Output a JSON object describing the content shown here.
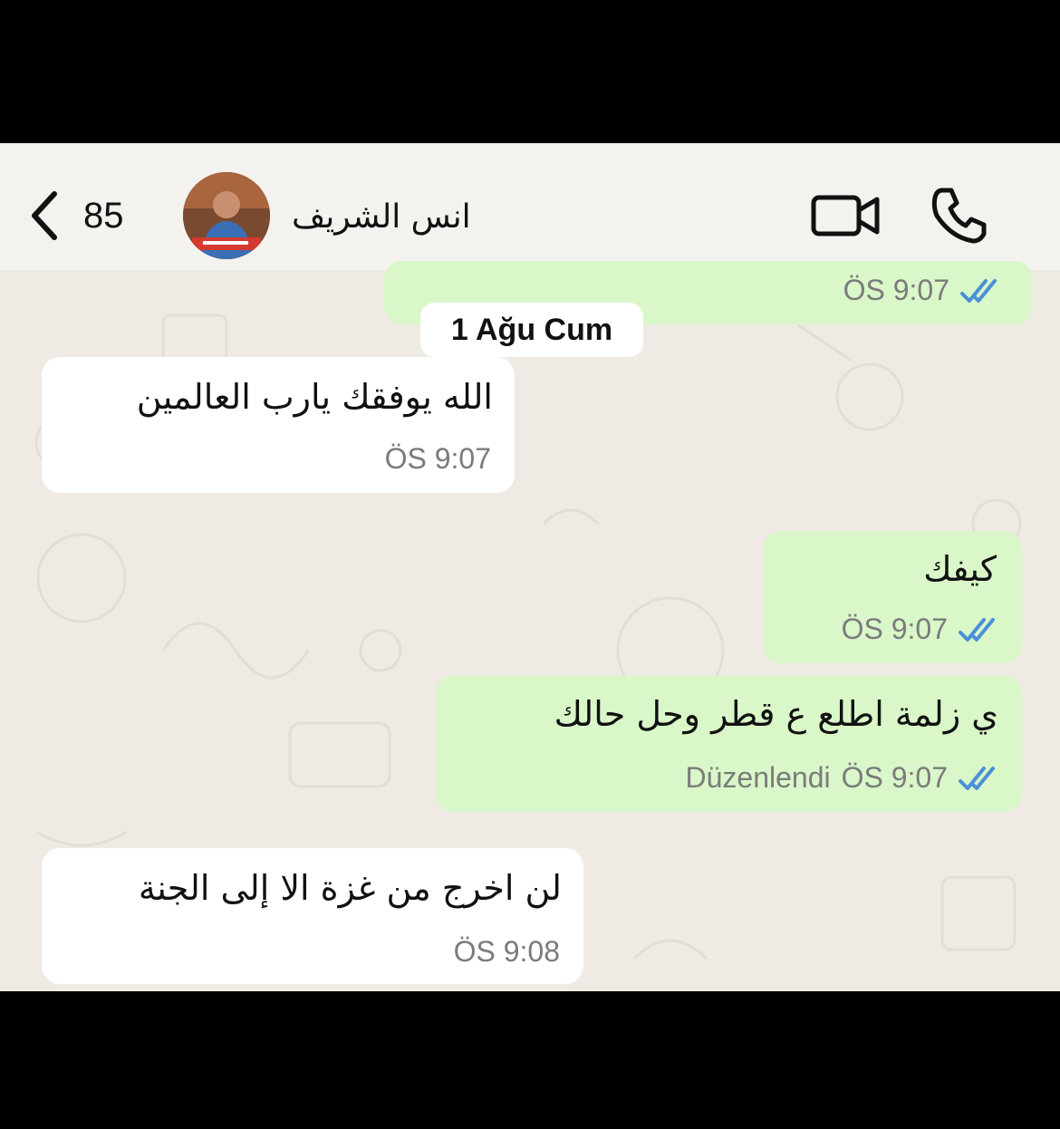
{
  "header": {
    "unread_count": "85",
    "contact_name": "انس الشريف"
  },
  "date_separator": "1 Ağu Cum",
  "messages": [
    {
      "direction": "out",
      "text": "",
      "time": "ÖS 9:07",
      "status": "read"
    },
    {
      "direction": "in",
      "text": "الله يوفقك يارب العالمين",
      "time": "ÖS 9:07"
    },
    {
      "direction": "out",
      "text": "كيفك",
      "time": "ÖS 9:07",
      "status": "read"
    },
    {
      "direction": "out",
      "text": "ي زلمة اطلع ع قطر وحل حالك",
      "edited_label": "Düzenlendi",
      "time": "ÖS 9:07",
      "status": "read"
    },
    {
      "direction": "in",
      "text": "لن اخرج من غزة الا إلى الجنة",
      "time": "ÖS 9:08"
    }
  ],
  "colors": {
    "incoming_bubble": "#ffffff",
    "outgoing_bubble": "#d9f7c8",
    "read_ticks": "#4a90d9",
    "wallpaper": "#efebe4"
  },
  "icons": [
    "back-chevron-icon",
    "video-call-icon",
    "phone-icon",
    "double-check-icon"
  ]
}
